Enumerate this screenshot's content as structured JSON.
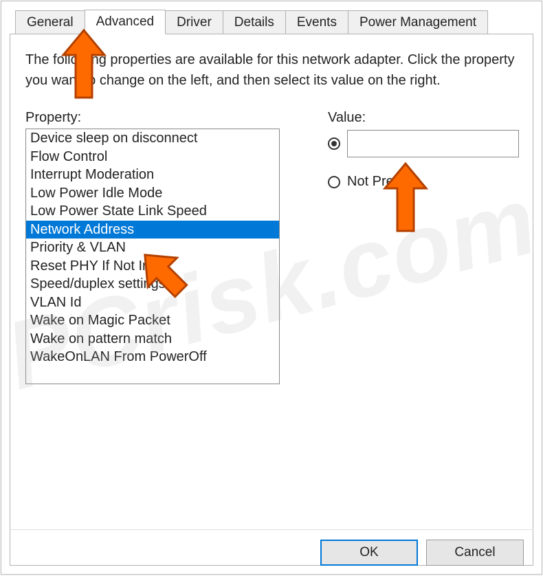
{
  "tabs": {
    "items": [
      {
        "label": "General"
      },
      {
        "label": "Advanced"
      },
      {
        "label": "Driver"
      },
      {
        "label": "Details"
      },
      {
        "label": "Events"
      },
      {
        "label": "Power Management"
      }
    ],
    "active_index": 1
  },
  "description": "The following properties are available for this network adapter. Click the property you want to change on the left, and then select its value on the right.",
  "property_label": "Property:",
  "value_label": "Value:",
  "properties": [
    "Device sleep on disconnect",
    "Flow Control",
    "Interrupt Moderation",
    "Low Power Idle Mode",
    "Low Power State Link Speed",
    "Network Address",
    "Priority & VLAN",
    "Reset PHY If Not In",
    "Speed/duplex settings",
    "VLAN Id",
    "Wake on Magic Packet",
    "Wake on pattern match",
    "WakeOnLAN From PowerOff"
  ],
  "selected_property_index": 5,
  "value": {
    "radio_value_selected": true,
    "input_value": "",
    "not_present_label": "Not Present"
  },
  "buttons": {
    "ok": "OK",
    "cancel": "Cancel"
  },
  "watermark": "PCrisk.com"
}
